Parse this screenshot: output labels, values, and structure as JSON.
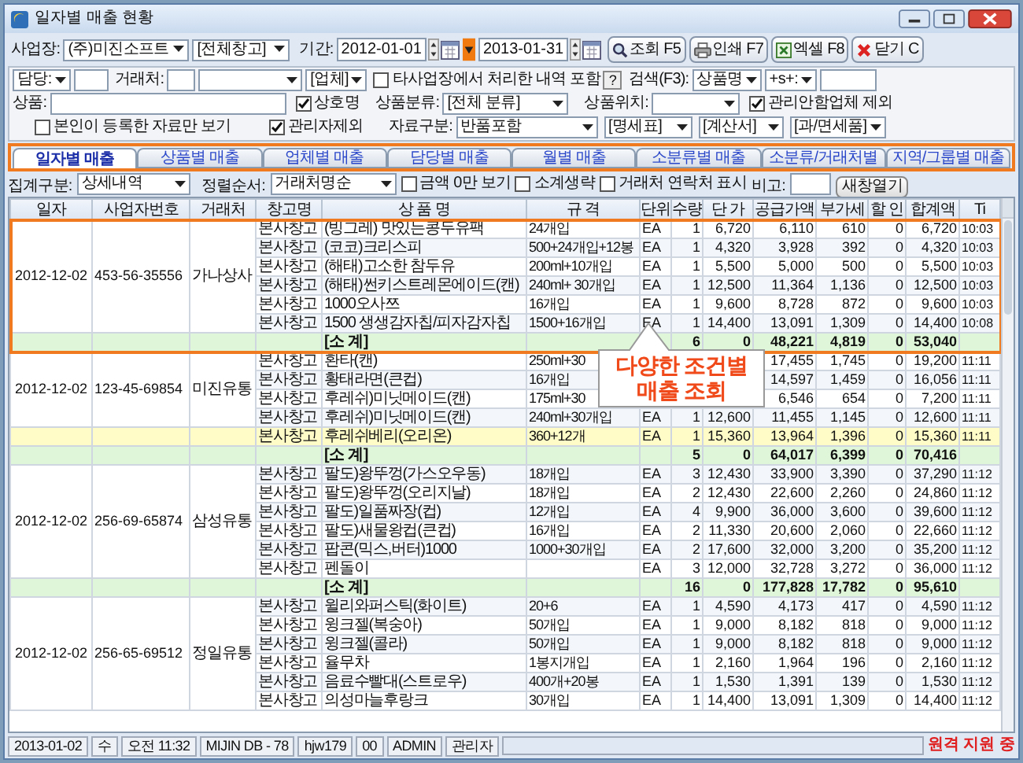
{
  "window": {
    "title": "일자별 매출 현황"
  },
  "toolbar": {
    "business_label": "사업장:",
    "business": "(주)미진소프트",
    "warehouse": "[전체창고]",
    "period_label": "기간:",
    "date_from": "2012-01-01",
    "date_to": "2013-01-31",
    "buttons": [
      {
        "label": "조회 F5",
        "kind": "search"
      },
      {
        "label": "인쇄 F7",
        "kind": "print"
      },
      {
        "label": "엑셀 F8",
        "kind": "excel"
      },
      {
        "label": "닫기 C",
        "kind": "close"
      }
    ]
  },
  "filters": [
    [
      {
        "kind": "select",
        "value": "담당:"
      },
      {
        "kind": "input"
      },
      {
        "kind": "label",
        "text": "거래처:"
      },
      {
        "kind": "input"
      },
      {
        "kind": "select"
      },
      {
        "kind": "select",
        "value": "[업체]"
      },
      {
        "kind": "checkbox",
        "label": "타사업장에서 처리한 내역 포함",
        "checked": false
      },
      {
        "kind": "help",
        "text": "?"
      },
      {
        "kind": "label",
        "text": "검색(F3):"
      },
      {
        "kind": "select",
        "value": "상품명"
      },
      {
        "kind": "select",
        "value": "+s+:"
      },
      {
        "kind": "input"
      }
    ],
    [
      {
        "kind": "label",
        "text": "상품:"
      },
      {
        "kind": "input"
      },
      {
        "kind": "checkbox",
        "label": "상호명",
        "checked": true
      },
      {
        "kind": "label",
        "text": "상품분류:"
      },
      {
        "kind": "select",
        "value": "[전체 분류]"
      },
      {
        "kind": "label",
        "text": "상품위치:"
      },
      {
        "kind": "select"
      },
      {
        "kind": "checkbox",
        "label": "관리안함업체 제외",
        "checked": true
      }
    ],
    [
      {
        "kind": "checkbox",
        "label": "본인이 등록한 자료만 보기",
        "checked": false
      },
      {
        "kind": "checkbox",
        "label": "관리자제외",
        "checked": true
      },
      {
        "kind": "label",
        "text": "자료구분:"
      },
      {
        "kind": "select",
        "value": "반품포함"
      },
      {
        "kind": "select",
        "value": "[명세표]"
      },
      {
        "kind": "select",
        "value": "[계산서]"
      },
      {
        "kind": "select",
        "value": "[과/면세품]"
      }
    ]
  ],
  "tabs": [
    {
      "label": "일자별 매출",
      "selected": true
    },
    {
      "label": "상품별 매출",
      "selected": false
    },
    {
      "label": "업체별 매출",
      "selected": false
    },
    {
      "label": "담당별 매출",
      "selected": false
    },
    {
      "label": "월별 매출",
      "selected": false
    },
    {
      "label": "소분류별 매출",
      "selected": false
    },
    {
      "label": "소분류/거래처별",
      "selected": false
    },
    {
      "label": "지역/그룹별 매출",
      "selected": false
    }
  ],
  "options": [
    {
      "kind": "label",
      "text": "집계구분:"
    },
    {
      "kind": "select",
      "value": "상세내역"
    },
    {
      "kind": "label",
      "text": "정렬순서:"
    },
    {
      "kind": "select",
      "value": "거래처명순"
    },
    {
      "kind": "checkbox",
      "label": "금액 0만 보기",
      "checked": false
    },
    {
      "kind": "checkbox",
      "label": "소계생략",
      "checked": false
    },
    {
      "kind": "checkbox",
      "label": "거래처 연락처 표시",
      "checked": false
    },
    {
      "kind": "label",
      "text": "비고:"
    },
    {
      "kind": "input"
    },
    {
      "kind": "button",
      "label": "새창열기"
    }
  ],
  "table": {
    "columns": [
      "일자",
      "사업자번호",
      "거래처",
      "창고명",
      "상 품 명",
      "규 격",
      "단위",
      "수량",
      "단 가",
      "공급가액",
      "부가세",
      "할 인",
      "합계액",
      "Ti"
    ],
    "groups": [
      {
        "date": "2012-12-02",
        "business_no": "453-56-35556",
        "customer": "가나상사",
        "outlined": true,
        "rows": [
          {
            "highlighted": false,
            "cells": [
              "본사창고",
              "(빙그레) 맛있는콩두유팩",
              "24개입",
              "EA",
              "1",
              "6,720",
              "6,110",
              "610",
              "0",
              "6,720",
              "10:03"
            ]
          },
          {
            "highlighted": false,
            "cells": [
              "본사창고",
              "(코코)크리스피",
              "500+24개입+12봉",
              "EA",
              "1",
              "4,320",
              "3,928",
              "392",
              "0",
              "4,320",
              "10:03"
            ]
          },
          {
            "highlighted": false,
            "cells": [
              "본사창고",
              "(해태)고소한 참두유",
              "200ml+10개입",
              "EA",
              "1",
              "5,500",
              "5,000",
              "500",
              "0",
              "5,500",
              "10:03"
            ]
          },
          {
            "highlighted": false,
            "cells": [
              "본사창고",
              "(해태)썬키스트레몬에이드(캔)",
              "240ml+ 30개입",
              "EA",
              "1",
              "12,500",
              "11,364",
              "1,136",
              "0",
              "12,500",
              "10:03"
            ]
          },
          {
            "highlighted": false,
            "cells": [
              "본사창고",
              "1000오사쯔",
              "16개입",
              "EA",
              "1",
              "9,600",
              "8,728",
              "872",
              "0",
              "9,600",
              "10:03"
            ]
          },
          {
            "highlighted": false,
            "cells": [
              "본사창고",
              "1500 생생감자칩/피자감자칩",
              "1500+16개입",
              "EA",
              "1",
              "14,400",
              "13,091",
              "1,309",
              "0",
              "14,400",
              "10:08"
            ]
          }
        ],
        "subtotal": [
          "[소 계]",
          "6",
          "0",
          "48,221",
          "4,819",
          "0",
          "53,040"
        ]
      },
      {
        "date": "2012-12-02",
        "business_no": "123-45-69854",
        "customer": "미진유통",
        "outlined": false,
        "rows": [
          {
            "highlighted": false,
            "cells": [
              "본사창고",
              "환타(캔)",
              "250ml+30",
              null,
              null,
              null,
              "17,455",
              "1,745",
              "0",
              "19,200",
              "11:11"
            ]
          },
          {
            "highlighted": false,
            "cells": [
              "본사창고",
              "황태라면(큰컵)",
              "16개입",
              null,
              null,
              null,
              "14,597",
              "1,459",
              "0",
              "16,056",
              "11:11"
            ]
          },
          {
            "highlighted": false,
            "cells": [
              "본사창고",
              "후레쉬)미닛메이드(캔)",
              "175ml+30",
              null,
              null,
              null,
              "6,546",
              "654",
              "0",
              "7,200",
              "11:11"
            ]
          },
          {
            "highlighted": false,
            "cells": [
              "본사창고",
              "후레쉬)미닛메이드(캔)",
              "240ml+30개입",
              "EA",
              "1",
              "12,600",
              "11,455",
              "1,145",
              "0",
              "12,600",
              "11:11"
            ]
          },
          {
            "highlighted": true,
            "cells": [
              "본사창고",
              "후레쉬베리(오리온)",
              "360+12개",
              "EA",
              "1",
              "15,360",
              "13,964",
              "1,396",
              "0",
              "15,360",
              "11:11"
            ]
          }
        ],
        "subtotal": [
          "[소 계]",
          "5",
          "0",
          "64,017",
          "6,399",
          "0",
          "70,416"
        ]
      },
      {
        "date": "2012-12-02",
        "business_no": "256-69-65874",
        "customer": "삼성유통",
        "outlined": false,
        "rows": [
          {
            "highlighted": false,
            "cells": [
              "본사창고",
              "팔도)왕뚜껑(가스오우동)",
              "18개입",
              "EA",
              "3",
              "12,430",
              "33,900",
              "3,390",
              "0",
              "37,290",
              "11:12"
            ]
          },
          {
            "highlighted": false,
            "cells": [
              "본사창고",
              "팔도)왕뚜껑(오리지날)",
              "18개입",
              "EA",
              "2",
              "12,430",
              "22,600",
              "2,260",
              "0",
              "24,860",
              "11:12"
            ]
          },
          {
            "highlighted": false,
            "cells": [
              "본사창고",
              "팔도)일품짜장(컵)",
              "12개입",
              "EA",
              "4",
              "9,900",
              "36,000",
              "3,600",
              "0",
              "39,600",
              "11:12"
            ]
          },
          {
            "highlighted": false,
            "cells": [
              "본사창고",
              "팔도)새물왕컵(큰컵)",
              "16개입",
              "EA",
              "2",
              "11,330",
              "20,600",
              "2,060",
              "0",
              "22,660",
              "11:12"
            ]
          },
          {
            "highlighted": false,
            "cells": [
              "본사창고",
              "팝콘(믹스,버터)1000",
              "1000+30개입",
              "EA",
              "2",
              "17,600",
              "32,000",
              "3,200",
              "0",
              "35,200",
              "11:12"
            ]
          },
          {
            "highlighted": false,
            "cells": [
              "본사창고",
              "펜돌이",
              null,
              "EA",
              "3",
              "12,000",
              "32,728",
              "3,272",
              "0",
              "36,000",
              "11:12"
            ]
          }
        ],
        "subtotal": [
          "[소 계]",
          "16",
          "0",
          "177,828",
          "17,782",
          "0",
          "95,610"
        ]
      },
      {
        "date": "2012-12-02",
        "business_no": "256-65-69512",
        "customer": "정일유통",
        "outlined": false,
        "rows": [
          {
            "highlighted": false,
            "cells": [
              "본사창고",
              "윌리와퍼스틱(화이트)",
              "20+6",
              "EA",
              "1",
              "4,590",
              "4,173",
              "417",
              "0",
              "4,590",
              "11:12"
            ]
          },
          {
            "highlighted": false,
            "cells": [
              "본사창고",
              "윙크젤(복숭아)",
              "50개입",
              "EA",
              "1",
              "9,000",
              "8,182",
              "818",
              "0",
              "9,000",
              "11:12"
            ]
          },
          {
            "highlighted": false,
            "cells": [
              "본사창고",
              "윙크젤(콜라)",
              "50개입",
              "EA",
              "1",
              "9,000",
              "8,182",
              "818",
              "0",
              "9,000",
              "11:12"
            ]
          },
          {
            "highlighted": false,
            "cells": [
              "본사창고",
              "율무차",
              "1봉지개입",
              "EA",
              "1",
              "2,160",
              "1,964",
              "196",
              "0",
              "2,160",
              "11:12"
            ]
          },
          {
            "highlighted": false,
            "cells": [
              "본사창고",
              "음료수빨대(스트로우)",
              "400개+20봉",
              "EA",
              "1",
              "1,530",
              "1,391",
              "139",
              "0",
              "1,530",
              "11:12"
            ]
          },
          {
            "highlighted": false,
            "cells": [
              "본사창고",
              "의성마늘후랑크",
              "30개입",
              "EA",
              "1",
              "14,400",
              "13,091",
              "1,309",
              "0",
              "14,400",
              "11:12"
            ]
          }
        ]
      }
    ]
  },
  "callout": {
    "lines": [
      "다양한 조건별",
      "매출 조회"
    ]
  },
  "status_bar": {
    "cells": [
      "2013-01-02",
      "수",
      "오전 11:32",
      "MIJIN DB - 78",
      "hjw179",
      "00",
      "ADMIN",
      "관리자"
    ],
    "notice": "원격 지원 중"
  }
}
